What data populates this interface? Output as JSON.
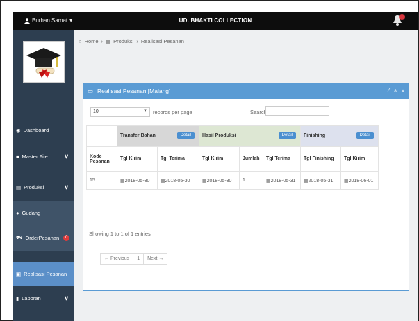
{
  "topbar": {
    "user": "Burhan Samat",
    "title": "UD. BHAKTI COLLECTION"
  },
  "sidebar": {
    "items": [
      {
        "label": "Dashboard"
      },
      {
        "label": "Master File"
      },
      {
        "label": "Produksi"
      },
      {
        "label": "Gudang"
      },
      {
        "label": "OrderPesanan",
        "badge": "0"
      },
      {
        "label": "Realisasi Pesanan"
      },
      {
        "label": "Laporan"
      }
    ]
  },
  "breadcrumb": {
    "home": "Home",
    "produksi": "Produksi",
    "current": "Realisasi Pesanan"
  },
  "panel": {
    "title": "Realisasi Pesanan [Malang]",
    "length_value": "10",
    "length_label": "records per page",
    "search_label": "Search:",
    "groups": {
      "transfer": "Transfer Bahan",
      "hasil": "Hasil Produksi",
      "finishing": "Finishing",
      "detail": "Detail"
    },
    "columns": [
      "Kode Pesanan",
      "Tgl Kirim",
      "Tgl Terima",
      "Tgl Kirim",
      "Jumlah",
      "Tgl Terima",
      "Tgl Finishing",
      "Tgl Kirim"
    ],
    "rows": [
      [
        "15",
        "2018-05-30",
        "2018-05-30",
        "2018-05-30",
        "1",
        "2018-05-31",
        "2018-05-31",
        "2018-06-01"
      ]
    ],
    "info": "Showing 1 to 1 of 1 entries",
    "pager": {
      "prev": "← Previous",
      "page": "1",
      "next": "Next →"
    }
  },
  "colors": {
    "topbar": "#0d0d0d",
    "sidebar": "#2d3e50",
    "active": "#5b8fc8",
    "panel": "#5a9bd4"
  }
}
